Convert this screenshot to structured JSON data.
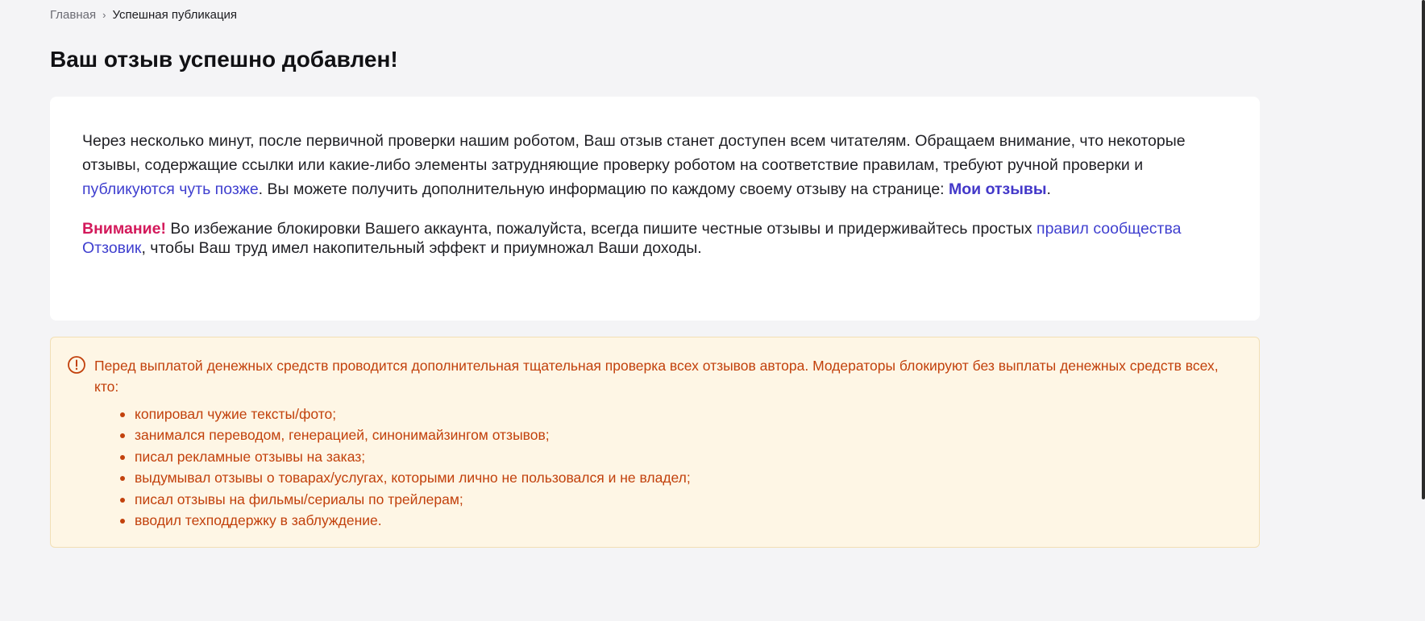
{
  "breadcrumb": {
    "home": "Главная",
    "separator": "›",
    "current": "Успешная публикация"
  },
  "page_title": "Ваш отзыв успешно добавлен!",
  "info_card": {
    "paragraph1": {
      "text_before_link": "Через несколько минут, после первичной проверки нашим роботом, Ваш отзыв станет доступен всем читателям. Обращаем внимание, что некоторые отзывы, содержащие ссылки или какие-либо элементы затрудняющие проверку роботом на соответствие правилам, требуют ручной проверки и ",
      "link_later": "публикуются чуть позже",
      "text_after_link": ". Вы можете получить дополнительную информацию по каждому своему отзыву на странице: ",
      "link_my_reviews": "Мои отзывы",
      "end": "."
    },
    "paragraph2": {
      "attention": "Внимание!",
      "text_before_link": " Во избежание блокировки Вашего аккаунта, пожалуйста, всегда пишите честные отзывы и придерживайтесь простых ",
      "link_rules": "правил сообщества Отзовик",
      "text_after_link": ", чтобы Ваш труд имел накопительный эффект и приумножал Ваши доходы."
    }
  },
  "warning": {
    "icon": "exclamation-circle-icon",
    "text": "Перед выплатой денежных средств проводится дополнительная тщательная проверка всех отзывов автора. Модераторы блокируют без выплаты денежных средств всех, кто:",
    "items": [
      "копировал чужие тексты/фото;",
      "занимался переводом, генерацией, синонимайзингом отзывов;",
      "писал рекламные отзывы на заказ;",
      "выдумывал отзывы о товарах/услугах, которыми лично не пользовался и не владел;",
      "писал отзывы на фильмы/сериалы по трейлерам;",
      "вводил техподдержку в заблуждение."
    ]
  },
  "colors": {
    "background": "#f4f4f6",
    "link": "#3f3fcf",
    "attention": "#d3195b",
    "warning_text": "#c2410c",
    "warning_background": "#fef6e5"
  }
}
